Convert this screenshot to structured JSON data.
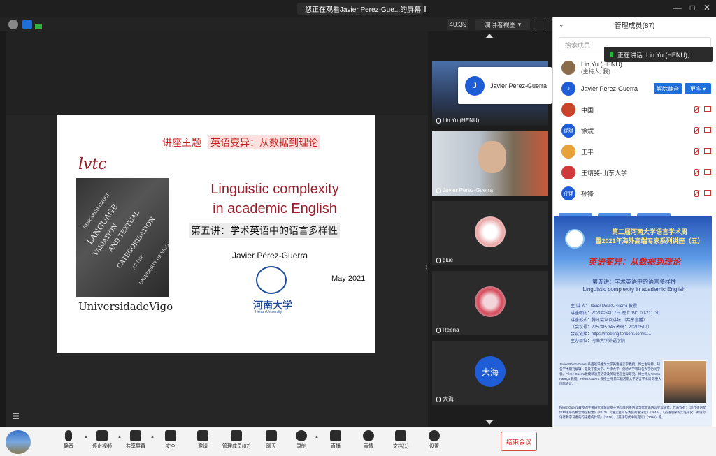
{
  "titlebar": {
    "share_text": "您正在观看Javier Perez-Gue...的屏幕",
    "win_min": "—",
    "win_max": "□",
    "win_close": "✕"
  },
  "infobar": {
    "timer": "40:39",
    "view_label": "演讲者视图",
    "view_caret": "▾"
  },
  "slide": {
    "topic_label": "讲座主题",
    "topic_value": "英语变异：从数据到理论",
    "lvtc": "lvtc",
    "book_lines": [
      "RESEARCH GROUP",
      "LANGUAGE",
      "VARIATION",
      "AND TEXTUAL",
      "CATEGORISATION",
      "AT THE",
      "UNIVERSITY OF VIGO"
    ],
    "university": "UniversidadeVigo",
    "title_line1": "Linguistic complexity",
    "title_line2": "in academic English",
    "lecture": "第五讲：学术英语中的语言多样性",
    "author": "Javier Pérez-Guerra",
    "date": "May 2021",
    "henan": "河南大学",
    "henan_en": "Henan University"
  },
  "gallery": {
    "tiles": [
      {
        "name": "Lin Yu (HENU)"
      },
      {
        "name": "Javier Perez-Guerra"
      },
      {
        "name": "glue"
      },
      {
        "name": "Reena"
      },
      {
        "name": "大海",
        "avatar": "大海"
      }
    ],
    "popup_avatar": "J",
    "popup_name": "Javier Perez-Guerra"
  },
  "panel": {
    "header": "管理成员(87)",
    "search_placeholder": "搜索成员",
    "speaking": "正在讲话: Lin Yu (HENU);",
    "participants": [
      {
        "name": "Lin Yu (HENU)",
        "sub": "(主持人, 我)",
        "avatar": "",
        "color": "#8a6d4a"
      },
      {
        "name": "Javier Perez-Guerra",
        "sub": "",
        "avatar": "J",
        "color": "#1e5dd6"
      },
      {
        "name": "中国",
        "sub": "",
        "avatar": "",
        "color": "#c8442a"
      },
      {
        "name": "徐斌",
        "sub": "",
        "avatar": "徐斌",
        "color": "#1e5dd6"
      },
      {
        "name": "王平",
        "sub": "",
        "avatar": "",
        "color": "#e8a23a"
      },
      {
        "name": "王靖斐-山东大学",
        "sub": "",
        "avatar": "",
        "color": "#d13a3a"
      },
      {
        "name": "孙锋",
        "sub": "",
        "avatar": "孙锋",
        "color": "#1e5dd6"
      }
    ],
    "unmute_label": "解除静音",
    "more_label": "更多 ▾"
  },
  "poster": {
    "title1": "第二届河南大学语言学术周",
    "title2": "暨2021年海外高端专家系列讲座（五）",
    "subtitle": "英语变异：从数据到理论",
    "lecture_cn": "第五讲：学术英语中的语言多样性",
    "lecture_en": "Linguistic complexity in academic English",
    "speaker": "主 讲 人：Javier Pérez-Guerra 教授",
    "time": "讲座时间：2021年5月17日 晚上 19：00-21：30",
    "platform": "讲座形式：腾讯会议及讲坛 （共享直播）",
    "meeting": "（会议号：275 385 345 密码：20210517）",
    "link": "会议链接：https://meeting.tencent.com/s/...",
    "host": "主办单位：河南大学外语学院",
    "bio": "Javier Pérez-Guerra系西班牙维戈大学英语语言学教授，博士生导师，知名学术期刊编辑，是爱丁堡大学、牛津大学、剑桥大学等知名大学访问学者。Pérez-Guerra教授精通英语史及英语语言变异研究。博士师从Teresa Fanego 教授。Pérez-Guerra 教授主持'第二届河南大学语言学术周'等重大国际会议。",
    "bio2": "Pérez-Guerra教授的主要研究领域是基于语料库的英语及当代英语语言变异研究。代表作有：《现代英语文体中语序的概念特征构建》（2013），《语言变异与演变的语法化》（2016），《英语语序的实证研究：英语母语者和学习者的句法结构比较》（2016），《英语句式中的变异》（2020）等。"
  },
  "toolbar": {
    "items": [
      "静音",
      "停止视频",
      "共享屏幕",
      "安全",
      "邀请",
      "管理成员(87)",
      "聊天",
      "录制",
      "直播",
      "表情",
      "文档(1)",
      "设置"
    ],
    "end_label": "结束会议"
  }
}
